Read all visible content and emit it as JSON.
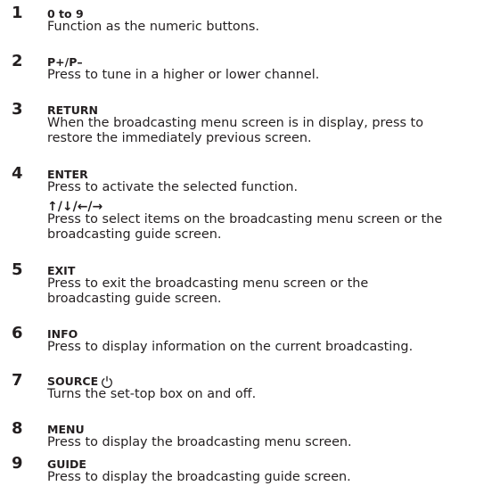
{
  "items": [
    {
      "number": "1",
      "title": "0 to 9",
      "description": "Function as the numeric buttons."
    },
    {
      "number": "2",
      "title": "P+/P–",
      "description": "Press to tune in a higher or lower channel."
    },
    {
      "number": "3",
      "title": "RETURN",
      "description_lines": [
        "When the broadcasting menu screen is in display, press to",
        "restore the immediately previous screen."
      ]
    },
    {
      "number": "4",
      "title": "ENTER",
      "description": "Press to activate the selected function.",
      "sub_title": "↑/↓/←/→",
      "sub_description_lines": [
        "Press to select items on the broadcasting menu screen or the",
        "broadcasting guide screen."
      ]
    },
    {
      "number": "5",
      "title": "EXIT",
      "description_lines": [
        "Press to exit the broadcasting menu screen or the",
        "broadcasting guide screen."
      ]
    },
    {
      "number": "6",
      "title": "INFO",
      "description": "Press to display information on the current broadcasting."
    },
    {
      "number": "7",
      "title": "SOURCE",
      "title_icon": "power-icon",
      "description": "Turns the set-top box on and off."
    },
    {
      "number": "8",
      "title": "MENU",
      "description": "Press to display the broadcasting menu screen."
    },
    {
      "number": "9",
      "title": "GUIDE",
      "description": "Press to display the broadcasting guide screen."
    }
  ]
}
